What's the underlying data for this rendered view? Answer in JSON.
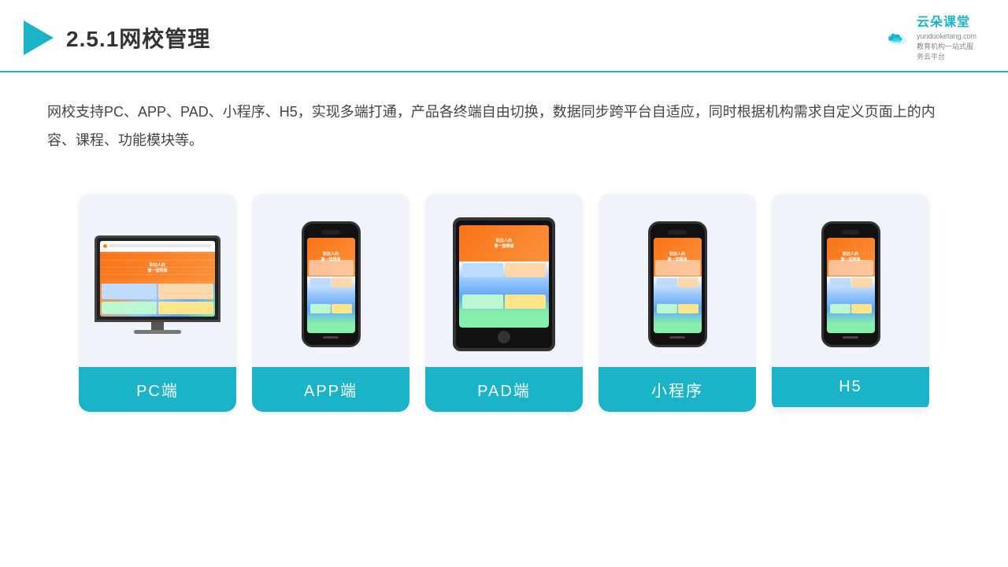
{
  "header": {
    "title": "2.5.1网校管理",
    "logo": {
      "name": "云朵课堂",
      "url": "yunduoketang.com",
      "tagline": "教育机构一站式服务云平台"
    }
  },
  "description": "网校支持PC、APP、PAD、小程序、H5，实现多端打通，产品各终端自由切换，数据同步跨平台自适应，同时根据机构需求自定义页面上的内容、课程、功能模块等。",
  "cards": [
    {
      "label": "PC端",
      "type": "pc"
    },
    {
      "label": "APP端",
      "type": "phone"
    },
    {
      "label": "PAD端",
      "type": "tablet"
    },
    {
      "label": "小程序",
      "type": "phone"
    },
    {
      "label": "H5",
      "type": "phone"
    }
  ]
}
